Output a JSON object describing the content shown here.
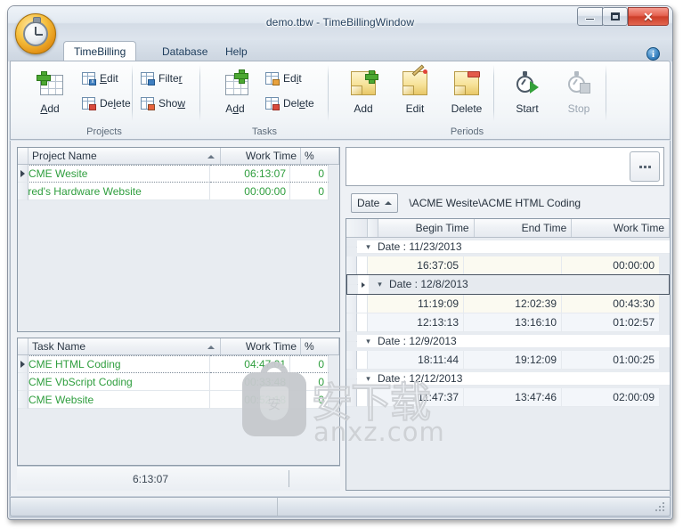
{
  "window": {
    "title": "demo.tbw - TimeBillingWindow",
    "app_icon": "stopwatch-icon",
    "minimize_label": "",
    "maximize_label": "",
    "close_label": "✕"
  },
  "ribbon": {
    "tabs": [
      {
        "label": "TimeBilling",
        "active": true
      },
      {
        "label": "Database",
        "active": false
      },
      {
        "label": "Help",
        "active": false
      }
    ],
    "info_label": "i",
    "groups": [
      {
        "name": "Projects",
        "label": "Projects",
        "big": [
          {
            "label": "Add",
            "icon": "table-add-icon",
            "accel": "A",
            "disabled": false
          }
        ],
        "small": [
          {
            "label": "Edit",
            "icon": "table-edit-icon",
            "accel": "E",
            "disabled": false
          },
          {
            "label": "Delete",
            "icon": "table-delete-icon",
            "accel": "l",
            "disabled": false
          },
          {
            "label": "Filter",
            "icon": "table-filter-icon",
            "accel": "r",
            "disabled": false
          },
          {
            "label": "Show",
            "icon": "table-show-icon",
            "accel": "w",
            "disabled": false
          }
        ]
      },
      {
        "name": "Tasks",
        "label": "Tasks",
        "big": [
          {
            "label": "Add",
            "icon": "table-add-icon",
            "accel": "d",
            "disabled": false
          }
        ],
        "small": [
          {
            "label": "Edit",
            "icon": "note-edit-icon",
            "accel": "i",
            "disabled": false
          },
          {
            "label": "Delete",
            "icon": "table-delete-icon",
            "accel": "e",
            "disabled": false
          }
        ]
      },
      {
        "name": "Periods",
        "label": "Periods",
        "big": [
          {
            "label": "Add",
            "icon": "note-add-icon",
            "disabled": false
          },
          {
            "label": "Edit",
            "icon": "note-edit-icon",
            "disabled": false
          },
          {
            "label": "Delete",
            "icon": "note-delete-icon",
            "disabled": false
          },
          {
            "label": "Start",
            "icon": "stopwatch-start-icon",
            "disabled": false
          },
          {
            "label": "Stop",
            "icon": "stopwatch-stop-icon",
            "disabled": true
          }
        ]
      }
    ]
  },
  "projects_grid": {
    "columns": [
      "Project Name",
      "Work Time",
      "%"
    ],
    "sort_column": "Project Name",
    "sort_dir": "asc",
    "rows": [
      {
        "name": "ACME Wesite",
        "work_time": "06:13:07",
        "percent": "0",
        "current": true
      },
      {
        "name": "Fred's Hardware Website",
        "work_time": "00:00:00",
        "percent": "0",
        "current": false
      }
    ]
  },
  "tasks_grid": {
    "columns": [
      "Task Name",
      "Work Time",
      "%"
    ],
    "sort_column": "Task Name",
    "sort_dir": "asc",
    "rows": [
      {
        "name": "ACME HTML Coding",
        "work_time": "04:47:01",
        "percent": "0",
        "current": true
      },
      {
        "name": "ACME VbScript Coding",
        "work_time": "00:33:48",
        "percent": "0",
        "current": false
      },
      {
        "name": "ACME Website",
        "work_time": "00:52:18",
        "percent": "0",
        "current": false
      }
    ]
  },
  "total": {
    "value": "6:13:07"
  },
  "periods_panel": {
    "ellipsis_label": "…",
    "group_button_label": "Date",
    "path": "\\ACME Wesite\\ACME HTML Coding",
    "columns": [
      "Begin Time",
      "End Time",
      "Work Time"
    ],
    "groups": [
      {
        "label": "Date : 11/23/2013",
        "selected": false,
        "rows": [
          {
            "begin": "16:37:05",
            "end": "",
            "work": "00:00:00",
            "style": "alt1"
          }
        ]
      },
      {
        "label": "Date : 12/8/2013",
        "selected": true,
        "rows": [
          {
            "begin": "11:19:09",
            "end": "12:02:39",
            "work": "00:43:30",
            "style": "alt1"
          },
          {
            "begin": "12:13:13",
            "end": "13:16:10",
            "work": "01:02:57",
            "style": "alt2"
          }
        ]
      },
      {
        "label": "Date : 12/9/2013",
        "selected": false,
        "rows": [
          {
            "begin": "18:11:44",
            "end": "19:12:09",
            "work": "01:00:25",
            "style": "alt2"
          }
        ]
      },
      {
        "label": "Date : 12/12/2013",
        "selected": false,
        "rows": [
          {
            "begin": "11:47:37",
            "end": "13:47:46",
            "work": "02:00:09",
            "style": "alt2"
          }
        ]
      }
    ]
  },
  "watermark": {
    "cn_text": "安下载",
    "url_text": "anxz.com",
    "shield_glyph": "安"
  },
  "colors": {
    "grid_text_green": "#2f9e3e",
    "accent_orange": "#f6c03e",
    "close_red": "#cc3d28",
    "info_blue": "#3f88c5"
  }
}
